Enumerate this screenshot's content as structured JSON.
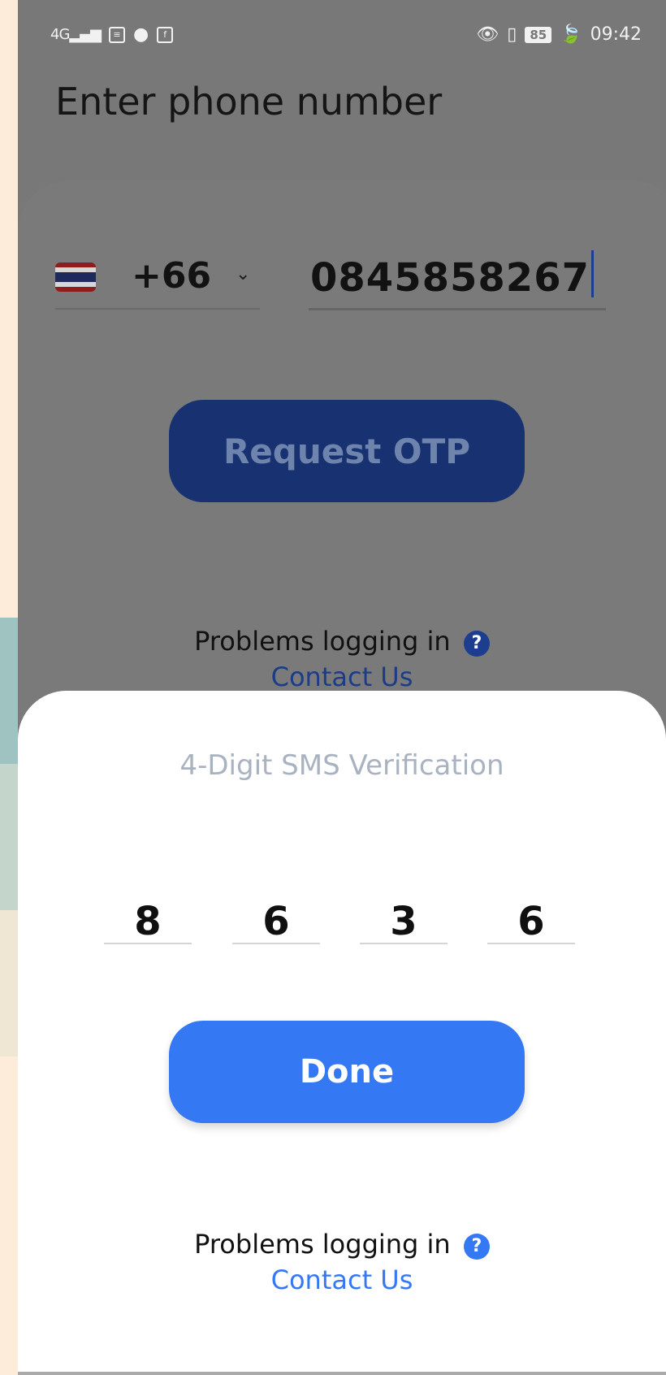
{
  "status_bar": {
    "network": "4G",
    "battery": "85",
    "time": "09:42",
    "icons": [
      "signal-icon",
      "news-icon",
      "line-icon",
      "facebook-icon",
      "eye-icon",
      "vibrate-icon",
      "battery-icon",
      "leaf-icon"
    ]
  },
  "page": {
    "title": "Enter phone number"
  },
  "phone_form": {
    "country_code": "+66",
    "phone_number": "0845858267",
    "request_button": "Request OTP",
    "problems_text": "Problems logging in",
    "contact_link": "Contact Us"
  },
  "otp_sheet": {
    "title": "4-Digit SMS Verification",
    "digits": [
      "8",
      "6",
      "3",
      "6"
    ],
    "done_button": "Done",
    "problems_text": "Problems logging in",
    "contact_link": "Contact Us"
  },
  "colors": {
    "primary": "#3478f4",
    "primary_dimmed": "#183271",
    "overlay": "#787878",
    "sheet_bg": "#ffffff"
  }
}
